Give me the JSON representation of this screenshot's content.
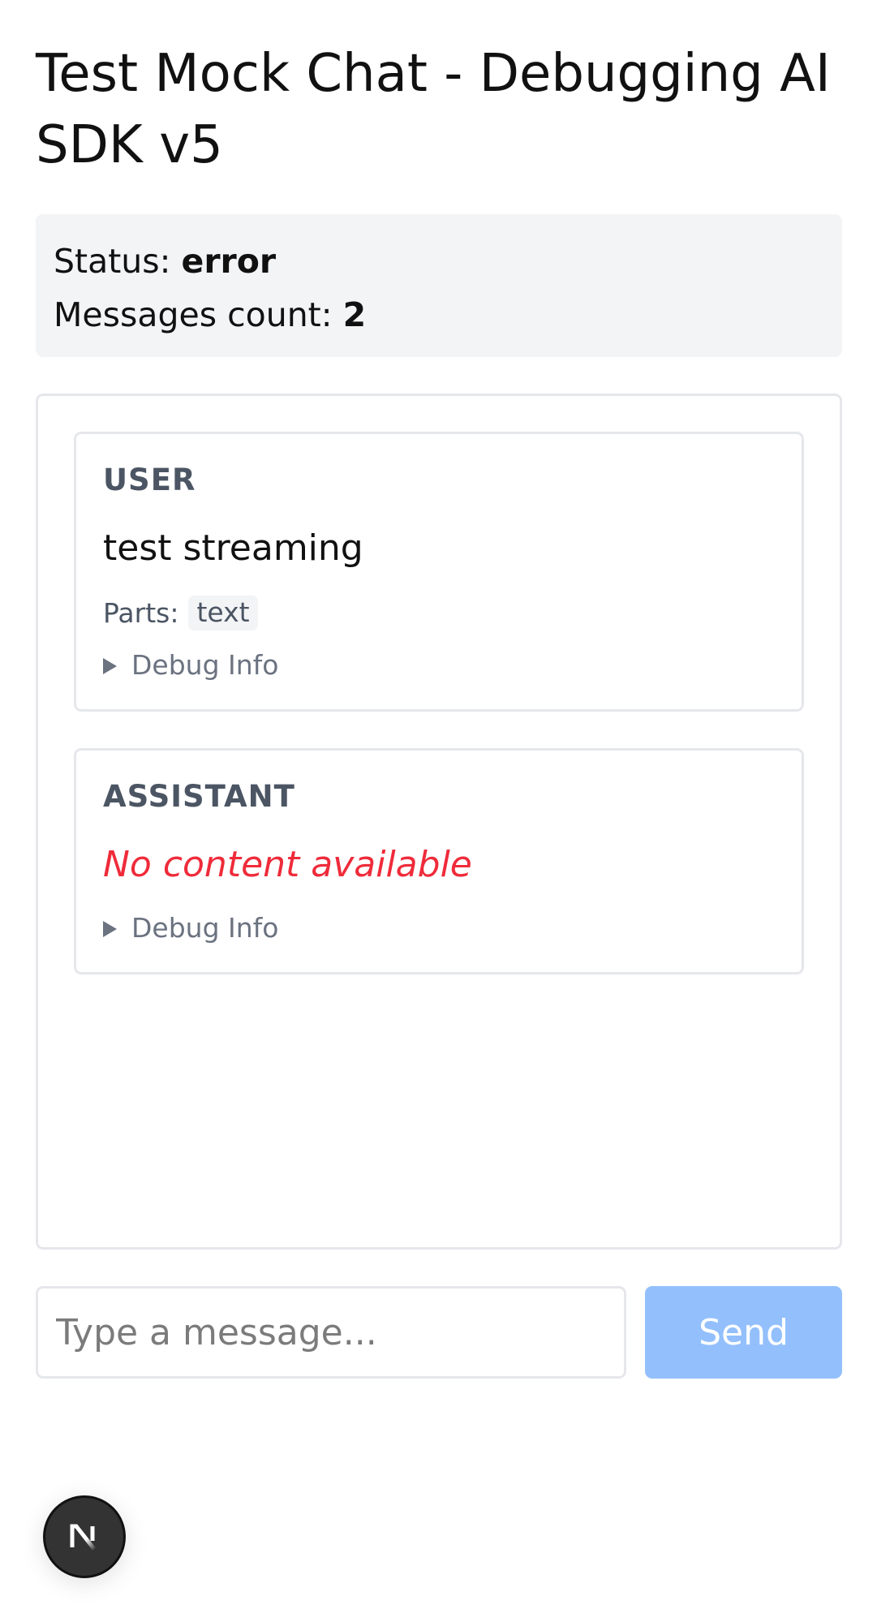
{
  "page": {
    "title": "Test Mock Chat - Debugging AI SDK v5"
  },
  "status": {
    "status_label": "Status:",
    "status_value": "error",
    "count_label": "Messages count:",
    "count_value": "2"
  },
  "messages": [
    {
      "role": "USER",
      "text": "test streaming",
      "parts_label": "Parts:",
      "parts": [
        "text"
      ],
      "debug_label": "Debug Info"
    },
    {
      "role": "ASSISTANT",
      "empty_text": "No content available",
      "debug_label": "Debug Info"
    }
  ],
  "composer": {
    "placeholder": "Type a message...",
    "value": "",
    "send_label": "Send"
  },
  "icons": {
    "debug_toggle": "disclosure-triangle-icon",
    "dev_badge": "nextjs-logo-icon"
  },
  "colors": {
    "error_text": "#ef2b3a",
    "send_button_disabled": "#93c0fd",
    "status_background": "#f3f4f6"
  }
}
